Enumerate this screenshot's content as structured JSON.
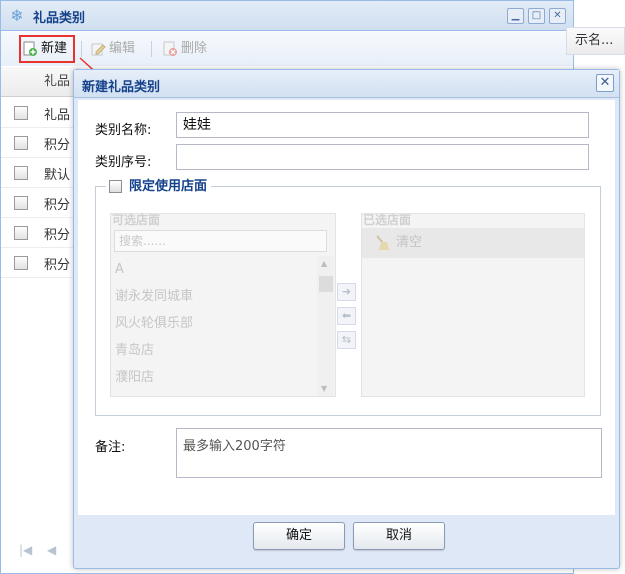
{
  "background_window": {
    "title": "礼品类别",
    "toolbar": {
      "new_label": "新建",
      "edit_label": "编辑",
      "delete_label": "删除"
    },
    "grid": {
      "header_text": "礼品",
      "rows": [
        "礼品",
        "积分",
        "默认",
        "积分",
        "积分",
        "积分"
      ]
    },
    "side_panel_text": "示名..."
  },
  "dialog": {
    "title": "新建礼品类别",
    "fields": {
      "category_name_label": "类别名称:",
      "category_name_value": "娃娃",
      "category_seq_label": "类别序号:",
      "category_seq_value": ""
    },
    "restrict_stores": {
      "label": "限定使用店面",
      "checked": false,
      "available": {
        "title": "可选店面",
        "search_placeholder": "搜索......",
        "items": [
          "A",
          "谢永发同城車",
          "风火轮俱乐部",
          "青岛店",
          "濮阳店"
        ]
      },
      "selected": {
        "title": "已选店面",
        "clear_label": "清空"
      }
    },
    "remarks": {
      "label": "备注:",
      "placeholder": "最多输入200字符"
    },
    "buttons": {
      "ok": "确定",
      "cancel": "取消"
    }
  },
  "colors": {
    "title_blue": "#15428b",
    "highlight_red": "#e8322f",
    "dialog_bg": "#dfe8f6"
  }
}
